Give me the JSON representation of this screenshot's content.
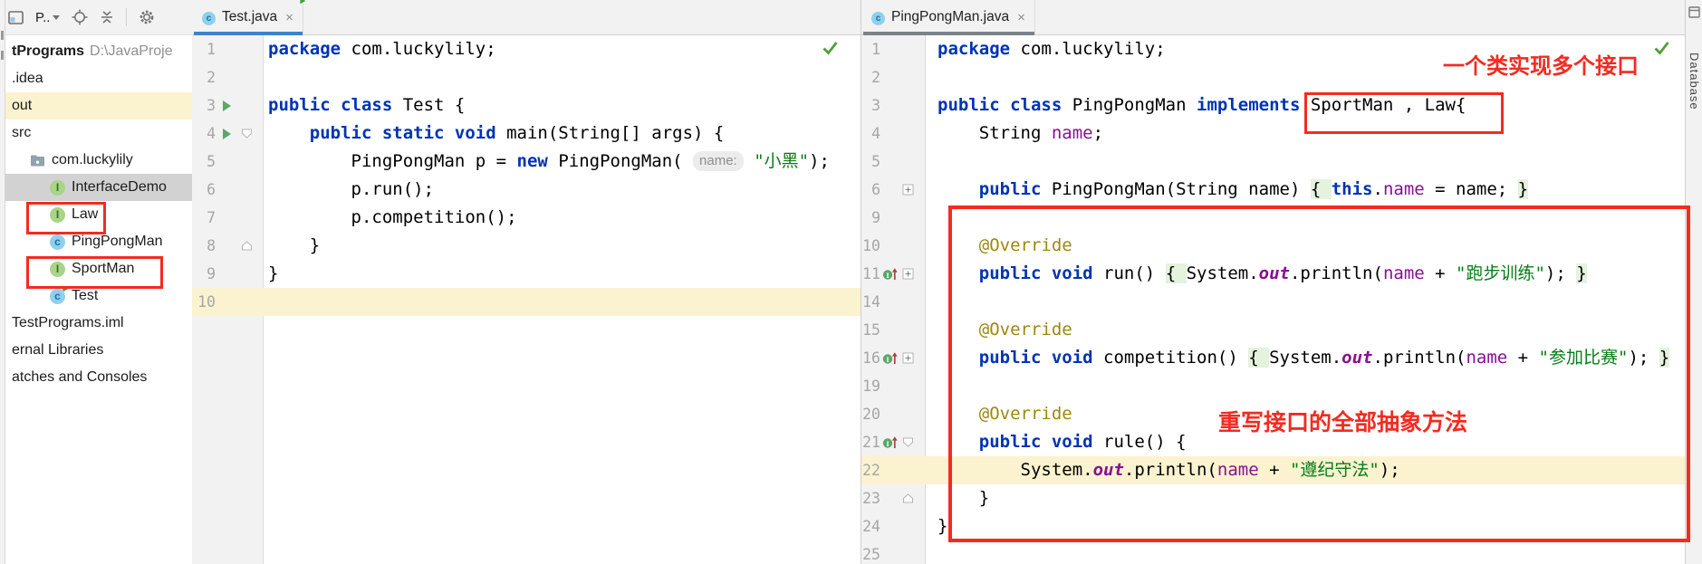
{
  "project_panel": {
    "toolbar": {
      "selector_label": "P.."
    },
    "tree": [
      {
        "label": "tPrograms",
        "suffix": " D:\\JavaProje",
        "type": "root",
        "indent": 0
      },
      {
        "label": ".idea",
        "type": "plain",
        "indent": 0
      },
      {
        "label": "out",
        "type": "plain",
        "indent": 0,
        "row_highlight": "yellow"
      },
      {
        "label": "src",
        "type": "plain",
        "indent": 0
      },
      {
        "label": "com.luckylily",
        "type": "folder",
        "indent": 1
      },
      {
        "label": "InterfaceDemo",
        "type": "interface",
        "indent": 2,
        "selected": true
      },
      {
        "label": "Law",
        "type": "interface",
        "indent": 2,
        "red_box": true
      },
      {
        "label": "PingPongMan",
        "type": "class",
        "indent": 2
      },
      {
        "label": "SportMan",
        "type": "interface",
        "indent": 2,
        "red_box": true
      },
      {
        "label": "Test",
        "type": "class-run",
        "indent": 2
      },
      {
        "label": "TestPrograms.iml",
        "type": "plain",
        "indent": 0
      },
      {
        "label": "ernal Libraries",
        "type": "plain",
        "indent": 0
      },
      {
        "label": "atches and Consoles",
        "type": "plain",
        "indent": 0
      }
    ]
  },
  "editors": [
    {
      "tab": {
        "title": "Test.java",
        "icon": "class-run",
        "close": "×",
        "underline": "#4083c9"
      },
      "inspection_ok": true,
      "lines": [
        {
          "n": "1",
          "tk": [
            [
              "k",
              "package"
            ],
            [
              "t",
              " com.luckylily;"
            ]
          ]
        },
        {
          "n": "2",
          "tk": []
        },
        {
          "n": "3",
          "g": {
            "run": true
          },
          "tk": [
            [
              "k",
              "public class"
            ],
            [
              "t",
              " Test {"
            ]
          ]
        },
        {
          "n": "4",
          "g": {
            "run": true,
            "fold": "open"
          },
          "tk": [
            [
              "t",
              "    "
            ],
            [
              "k",
              "public static void"
            ],
            [
              "t",
              " main(String[] args) {"
            ]
          ]
        },
        {
          "n": "5",
          "tk": [
            [
              "t",
              "        PingPongMan p = "
            ],
            [
              "k",
              "new"
            ],
            [
              "t",
              " PingPongMan( "
            ],
            [
              "h",
              "name:"
            ],
            [
              "t",
              " "
            ],
            [
              "s",
              "\"小黑\""
            ],
            [
              "t",
              ");"
            ]
          ]
        },
        {
          "n": "6",
          "tk": [
            [
              "t",
              "        p.run();"
            ]
          ]
        },
        {
          "n": "7",
          "tk": [
            [
              "t",
              "        p.competition();"
            ]
          ]
        },
        {
          "n": "8",
          "g": {
            "fold": "close"
          },
          "tk": [
            [
              "t",
              "    }"
            ]
          ]
        },
        {
          "n": "9",
          "tk": [
            [
              "t",
              "}"
            ]
          ]
        },
        {
          "n": "10",
          "caret": true,
          "tk": []
        }
      ]
    },
    {
      "tab": {
        "title": "PingPongMan.java",
        "icon": "class",
        "close": "×",
        "underline": "#7b838a"
      },
      "inspection_ok": true,
      "lines": [
        {
          "n": "1",
          "tk": [
            [
              "k",
              "package"
            ],
            [
              "t",
              " com.luckylily;"
            ]
          ]
        },
        {
          "n": "2",
          "tk": []
        },
        {
          "n": "3",
          "tk": [
            [
              "k",
              "public class"
            ],
            [
              "t",
              " PingPongMan "
            ],
            [
              "k",
              "implements"
            ],
            [
              "t",
              " SportMan , Law{"
            ]
          ]
        },
        {
          "n": "4",
          "tk": [
            [
              "t",
              "    String "
            ],
            [
              "f",
              "name"
            ],
            [
              "t",
              ";"
            ]
          ]
        },
        {
          "n": "5",
          "tk": []
        },
        {
          "n": "6",
          "g": {
            "fold": "plus"
          },
          "tk": [
            [
              "t",
              "    "
            ],
            [
              "k",
              "public"
            ],
            [
              "t",
              " PingPongMan(String name) "
            ],
            [
              "t",
              "{ ",
              "bg"
            ],
            [
              "k",
              "this"
            ],
            [
              "t",
              "."
            ],
            [
              "f",
              "name"
            ],
            [
              "t",
              " = name; "
            ],
            [
              "t",
              "}",
              "bg"
            ]
          ]
        },
        {
          "n": "9",
          "tk": []
        },
        {
          "n": "10",
          "tk": [
            [
              "t",
              "    "
            ],
            [
              "a",
              "@Override"
            ]
          ]
        },
        {
          "n": "11",
          "g": {
            "ovr": true,
            "fold": "plus"
          },
          "tk": [
            [
              "t",
              "    "
            ],
            [
              "k",
              "public void"
            ],
            [
              "t",
              " run() "
            ],
            [
              "t",
              "{ ",
              "bg"
            ],
            [
              "t",
              "System."
            ],
            [
              "o",
              "out"
            ],
            [
              "t",
              ".println("
            ],
            [
              "f",
              "name"
            ],
            [
              "t",
              " + "
            ],
            [
              "s",
              "\"跑步训练\""
            ],
            [
              "t",
              "); "
            ],
            [
              "t",
              "}",
              "bg"
            ]
          ]
        },
        {
          "n": "14",
          "tk": []
        },
        {
          "n": "15",
          "tk": [
            [
              "t",
              "    "
            ],
            [
              "a",
              "@Override"
            ]
          ]
        },
        {
          "n": "16",
          "g": {
            "ovr": true,
            "fold": "plus"
          },
          "tk": [
            [
              "t",
              "    "
            ],
            [
              "k",
              "public void"
            ],
            [
              "t",
              " competition() "
            ],
            [
              "t",
              "{ ",
              "bg"
            ],
            [
              "t",
              "System."
            ],
            [
              "o",
              "out"
            ],
            [
              "t",
              ".println("
            ],
            [
              "f",
              "name"
            ],
            [
              "t",
              " + "
            ],
            [
              "s",
              "\"参加比赛\""
            ],
            [
              "t",
              "); "
            ],
            [
              "t",
              "}",
              "bg"
            ]
          ]
        },
        {
          "n": "19",
          "tk": []
        },
        {
          "n": "20",
          "tk": [
            [
              "t",
              "    "
            ],
            [
              "a",
              "@Override"
            ]
          ]
        },
        {
          "n": "21",
          "g": {
            "ovr": true,
            "fold": "open"
          },
          "tk": [
            [
              "t",
              "    "
            ],
            [
              "k",
              "public void"
            ],
            [
              "t",
              " rule() {"
            ]
          ]
        },
        {
          "n": "22",
          "caret": true,
          "tk": [
            [
              "t",
              "        System."
            ],
            [
              "o",
              "out"
            ],
            [
              "t",
              ".println("
            ],
            [
              "f",
              "name"
            ],
            [
              "t",
              " + "
            ],
            [
              "s",
              "\"遵纪守法\""
            ],
            [
              "t",
              ");"
            ]
          ]
        },
        {
          "n": "23",
          "g": {
            "fold": "close"
          },
          "tk": [
            [
              "t",
              "    }"
            ]
          ]
        },
        {
          "n": "24",
          "tk": [
            [
              "t",
              "}"
            ]
          ]
        },
        {
          "n": "25",
          "tk": []
        }
      ]
    }
  ],
  "annotations": {
    "top_note": "一个类实现多个接口",
    "middle_note": "重写接口的全部抽象方法"
  },
  "right_strip": {
    "label": "Database"
  },
  "colors": {
    "keyword": "#0033b3",
    "string": "#067d17",
    "field": "#871094",
    "annotation": "#9e880d",
    "caret_line": "#fbf2cf",
    "fold_highlight": "#e4f2de",
    "red_annotation": "#f32b20",
    "tab_underline_active": "#4083c9",
    "tab_underline_inactive": "#7b838a",
    "tree_selection": "#d2d2d2"
  }
}
